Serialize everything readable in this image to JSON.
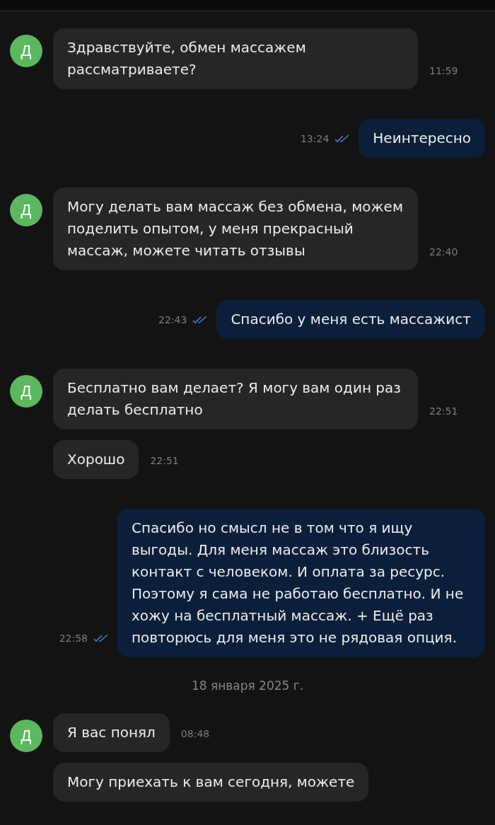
{
  "messages": [
    {
      "kind": "incoming",
      "avatar": true,
      "avatar_letter": "Д",
      "text": "Здравствуйте, обмен массажем рассматриваете?",
      "time": "11:59"
    },
    {
      "kind": "outgoing",
      "text": "Неинтересно",
      "time": "13:24",
      "read": true
    },
    {
      "kind": "incoming",
      "avatar": true,
      "avatar_letter": "Д",
      "text": "Могу делать вам массаж без обмена, можем поделить опытом, у меня прекрасный массаж, можете читать отзывы",
      "time": "22:40"
    },
    {
      "kind": "outgoing",
      "text": "Спасибо у меня есть массажист",
      "time": "22:43",
      "read": true
    },
    {
      "kind": "incoming",
      "avatar": true,
      "avatar_letter": "Д",
      "text": "Бесплатно вам делает? Я могу вам один раз делать бесплатно",
      "time": "22:51"
    },
    {
      "kind": "incoming",
      "avatar": false,
      "text": "Хорошо",
      "time": "22:51"
    },
    {
      "kind": "outgoing",
      "text": "Спасибо но смысл не в том что я ищу выгоды. Для меня массаж это близость контакт с человеком.  И оплата за ресурс. Поэтому я сама не работаю бесплатно.  И не хожу на бесплатный массаж. + Ещё раз повторюсь для меня это не рядовая опция.",
      "time": "22:58",
      "read": true
    },
    {
      "kind": "date",
      "text": "18 января 2025 г."
    },
    {
      "kind": "incoming",
      "avatar": true,
      "avatar_letter": "Д",
      "text": "Я вас понял",
      "time": "08:48"
    },
    {
      "kind": "incoming",
      "avatar": false,
      "text": "Могу приехать к вам сегодня, можете"
    }
  ]
}
